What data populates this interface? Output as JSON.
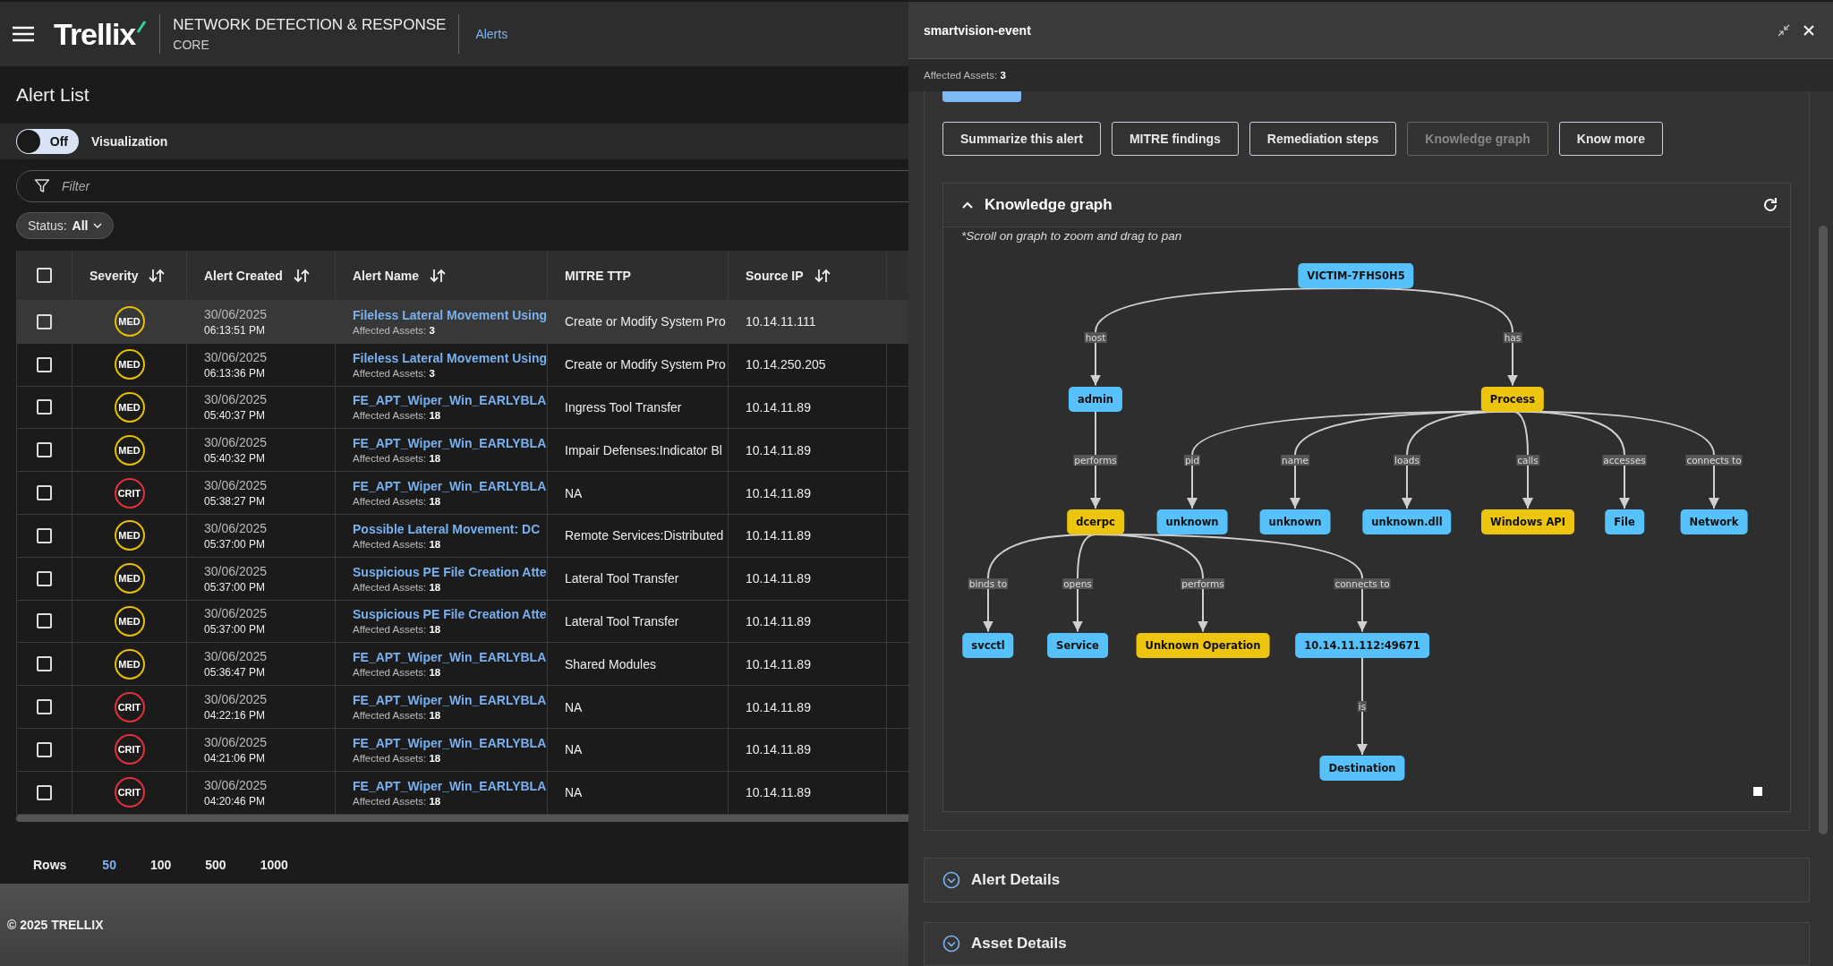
{
  "header": {
    "logo": "Trellix",
    "product": "NETWORK DETECTION & RESPONSE",
    "edition": "CORE",
    "nav": [
      {
        "label": "Alerts",
        "selected": true
      }
    ]
  },
  "page_title": "Alert List",
  "visualization": {
    "toggle_text": "Off",
    "on": false,
    "label": "Visualization"
  },
  "filter": {
    "placeholder": "Filter"
  },
  "status_filter": {
    "label": "Status:",
    "value": "All"
  },
  "table": {
    "header_checked": false,
    "columns": [
      {
        "label": "Severity",
        "sortable": true
      },
      {
        "label": "Alert Created",
        "sortable": true
      },
      {
        "label": "Alert Name",
        "sortable": true
      },
      {
        "label": "MITRE TTP",
        "sortable": false
      },
      {
        "label": "Source IP",
        "sortable": true
      }
    ],
    "rows": [
      {
        "checked": false,
        "selected": true,
        "severity": {
          "label": "MED",
          "color": "#e5c100"
        },
        "date": "30/06/2025",
        "time": "06:13:51 PM",
        "alert_name": "Fileless Lateral Movement Using",
        "assets": "Affected Assets: **3**",
        "mitre_ttp": "Create or Modify System Pro",
        "source_ip": "10.14.11.111"
      },
      {
        "checked": false,
        "selected": false,
        "severity": {
          "label": "MED",
          "color": "#e5c100"
        },
        "date": "30/06/2025",
        "time": "06:13:36 PM",
        "alert_name": "Fileless Lateral Movement Using",
        "assets": "Affected Assets: **3**",
        "mitre_ttp": "Create or Modify System Pro",
        "source_ip": "10.14.250.205"
      },
      {
        "checked": false,
        "selected": false,
        "severity": {
          "label": "MED",
          "color": "#e5c100"
        },
        "date": "30/06/2025",
        "time": "05:40:37 PM",
        "alert_name": "FE_APT_Wiper_Win_EARLYBLA",
        "assets": "Affected Assets: **18**",
        "mitre_ttp": "Ingress Tool Transfer",
        "source_ip": "10.14.11.89"
      },
      {
        "checked": false,
        "selected": false,
        "severity": {
          "label": "MED",
          "color": "#e5c100"
        },
        "date": "30/06/2025",
        "time": "05:40:32 PM",
        "alert_name": "FE_APT_Wiper_Win_EARLYBLA",
        "assets": "Affected Assets: **18**",
        "mitre_ttp": "Impair Defenses:Indicator Bl",
        "source_ip": "10.14.11.89"
      },
      {
        "checked": false,
        "selected": false,
        "severity": {
          "label": "CRIT",
          "color": "#e0303c"
        },
        "date": "30/06/2025",
        "time": "05:38:27 PM",
        "alert_name": "FE_APT_Wiper_Win_EARLYBLA",
        "assets": "Affected Assets: **18**",
        "mitre_ttp": "NA",
        "source_ip": "10.14.11.89"
      },
      {
        "checked": false,
        "selected": false,
        "severity": {
          "label": "MED",
          "color": "#e5c100"
        },
        "date": "30/06/2025",
        "time": "05:37:00 PM",
        "alert_name": "Possible Lateral Movement: DC",
        "assets": "Affected Assets: **18**",
        "mitre_ttp": "Remote Services:Distributed",
        "source_ip": "10.14.11.89"
      },
      {
        "checked": false,
        "selected": false,
        "severity": {
          "label": "MED",
          "color": "#e5c100"
        },
        "date": "30/06/2025",
        "time": "05:37:00 PM",
        "alert_name": "Suspicious PE File Creation Atte",
        "assets": "Affected Assets: **18**",
        "mitre_ttp": "Lateral Tool Transfer",
        "source_ip": "10.14.11.89"
      },
      {
        "checked": false,
        "selected": false,
        "severity": {
          "label": "MED",
          "color": "#e5c100"
        },
        "date": "30/06/2025",
        "time": "05:37:00 PM",
        "alert_name": "Suspicious PE File Creation Atte",
        "assets": "Affected Assets: **18**",
        "mitre_ttp": "Lateral Tool Transfer",
        "source_ip": "10.14.11.89"
      },
      {
        "checked": false,
        "selected": false,
        "severity": {
          "label": "MED",
          "color": "#e5c100"
        },
        "date": "30/06/2025",
        "time": "05:36:47 PM",
        "alert_name": "FE_APT_Wiper_Win_EARLYBLA",
        "assets": "Affected Assets: **18**",
        "mitre_ttp": "Shared Modules",
        "source_ip": "10.14.11.89"
      },
      {
        "checked": false,
        "selected": false,
        "severity": {
          "label": "CRIT",
          "color": "#e0303c"
        },
        "date": "30/06/2025",
        "time": "04:22:16 PM",
        "alert_name": "FE_APT_Wiper_Win_EARLYBLA",
        "assets": "Affected Assets: **18**",
        "mitre_ttp": "NA",
        "source_ip": "10.14.11.89"
      },
      {
        "checked": false,
        "selected": false,
        "severity": {
          "label": "CRIT",
          "color": "#e0303c"
        },
        "date": "30/06/2025",
        "time": "04:21:06 PM",
        "alert_name": "FE_APT_Wiper_Win_EARLYBLA",
        "assets": "Affected Assets: **18**",
        "mitre_ttp": "NA",
        "source_ip": "10.14.11.89"
      },
      {
        "checked": false,
        "selected": false,
        "severity": {
          "label": "CRIT",
          "color": "#e0303c"
        },
        "date": "30/06/2025",
        "time": "04:20:46 PM",
        "alert_name": "FE_APT_Wiper_Win_EARLYBLA",
        "assets": "Affected Assets: **18**",
        "mitre_ttp": "NA",
        "source_ip": "10.14.11.89"
      }
    ]
  },
  "pagination": {
    "label": "Rows",
    "options": [
      {
        "label": "50",
        "selected": true
      },
      {
        "label": "100",
        "selected": false
      },
      {
        "label": "500",
        "selected": false
      },
      {
        "label": "1000",
        "selected": false
      }
    ]
  },
  "footer": "© 2025 TRELLIX",
  "panel": {
    "title": "smartvision-event",
    "subtitle": "Affected Assets: **3**",
    "actions": [
      {
        "label": "Summarize this alert",
        "disabled": false
      },
      {
        "label": "MITRE findings",
        "disabled": false
      },
      {
        "label": "Remediation steps",
        "disabled": false
      },
      {
        "label": "Knowledge graph",
        "disabled": true
      },
      {
        "label": "Know more",
        "disabled": false
      }
    ],
    "knowledge_graph": {
      "title": "Knowledge graph",
      "expanded": true,
      "hint": "*Scroll on graph to zoom and drag to pan",
      "root": {
        "label": "VICTIM-7FHS0H5",
        "color": "#56c1fa",
        "children": [
          {
            "edge": "host",
            "label": "admin",
            "color": "#56c1fa",
            "children": [
              {
                "edge": "performs",
                "label": "dcerpc",
                "color": "#eec50e",
                "children": [
                  {
                    "edge": "binds to",
                    "label": "svcctl",
                    "color": "#56c1fa"
                  },
                  {
                    "edge": "opens",
                    "label": "Service",
                    "color": "#56c1fa"
                  },
                  {
                    "edge": "performs",
                    "label": "Unknown Operation",
                    "color": "#eec50e"
                  },
                  {
                    "edge": "connects to",
                    "label": "10.14.11.112:49671",
                    "color": "#56c1fa",
                    "children": [
                      {
                        "edge": "is",
                        "label": "Destination",
                        "color": "#56c1fa"
                      }
                    ]
                  }
                ]
              }
            ]
          },
          {
            "edge": "has",
            "label": "Process",
            "color": "#eec50e",
            "children": [
              {
                "edge": "pid",
                "label": "unknown",
                "color": "#56c1fa"
              },
              {
                "edge": "name",
                "label": "unknown",
                "color": "#56c1fa"
              },
              {
                "edge": "loads",
                "label": "unknown.dll",
                "color": "#56c1fa"
              },
              {
                "edge": "calls",
                "label": "Windows API",
                "color": "#eec50e"
              },
              {
                "edge": "accesses",
                "label": "File",
                "color": "#56c1fa"
              },
              {
                "edge": "connects to",
                "label": "Network",
                "color": "#56c1fa"
              }
            ]
          }
        ]
      }
    },
    "sections": [
      {
        "title": "Alert Details",
        "expanded": false
      },
      {
        "title": "Asset Details",
        "expanded": false
      }
    ]
  }
}
